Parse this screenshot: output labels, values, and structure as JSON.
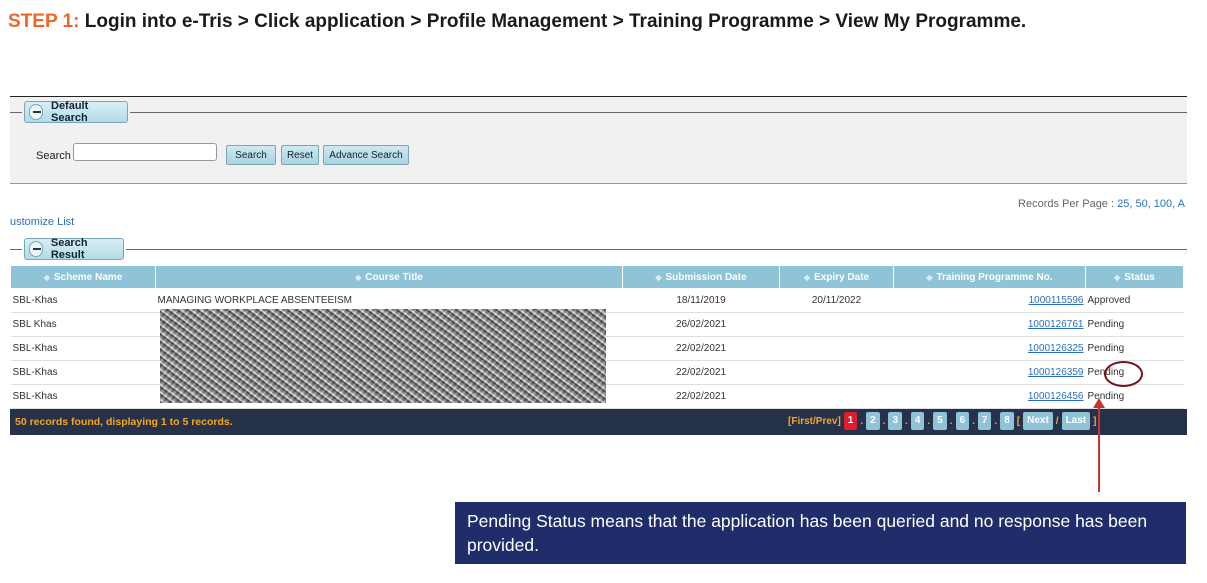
{
  "instruction": {
    "lead": "STEP 1:",
    "text": " Login into e-Tris > Click application > Profile Management > Training Programme > View My Programme."
  },
  "default_search": {
    "legend": "Default Search",
    "search_label": "Search",
    "search_value": "",
    "buttons": {
      "search": "Search",
      "reset": "Reset",
      "advance": "Advance Search"
    }
  },
  "records_per_page": {
    "label": "Records Per Page : ",
    "options": "25, 50, 100, A"
  },
  "customize_list": "ustomize List",
  "search_result": {
    "legend": "Search Result",
    "columns": [
      "Scheme Name",
      "Course Title",
      "Submission Date",
      "Expiry Date",
      "Training Programme No.",
      "Status"
    ],
    "rows": [
      {
        "scheme": "SBL-Khas",
        "course": "MANAGING WORKPLACE ABSENTEEISM",
        "submission": "18/11/2019",
        "expiry": "20/11/2022",
        "tp_no": "1000115596",
        "status": "Approved"
      },
      {
        "scheme": "SBL Khas",
        "course": "",
        "submission": "26/02/2021",
        "expiry": "",
        "tp_no": "1000126761",
        "status": "Pending"
      },
      {
        "scheme": "SBL-Khas",
        "course": "",
        "submission": "22/02/2021",
        "expiry": "",
        "tp_no": "1000126325",
        "status": "Pending"
      },
      {
        "scheme": "SBL-Khas",
        "course": "",
        "submission": "22/02/2021",
        "expiry": "",
        "tp_no": "1000126359",
        "status": "Pending"
      },
      {
        "scheme": "SBL-Khas",
        "course": "",
        "submission": "22/02/2021",
        "expiry": "",
        "tp_no": "1000126456",
        "status": "Pending"
      }
    ]
  },
  "footer": {
    "found": "50 records found, displaying 1 to 5 records.",
    "first_prev": "[First/Prev]",
    "pages": [
      "1",
      "2",
      "3",
      "4",
      "5",
      "6",
      "7",
      "8"
    ],
    "current_page": "1",
    "next": "Next",
    "last": "Last"
  },
  "callout": "Pending Status means that the application has been queried and no response has been provided.",
  "colors": {
    "lead": "#f26522",
    "header": "#8ec3d8",
    "footer": "#25324a",
    "callout_bg": "#1f2d6b",
    "arrow": "#c0392b"
  }
}
